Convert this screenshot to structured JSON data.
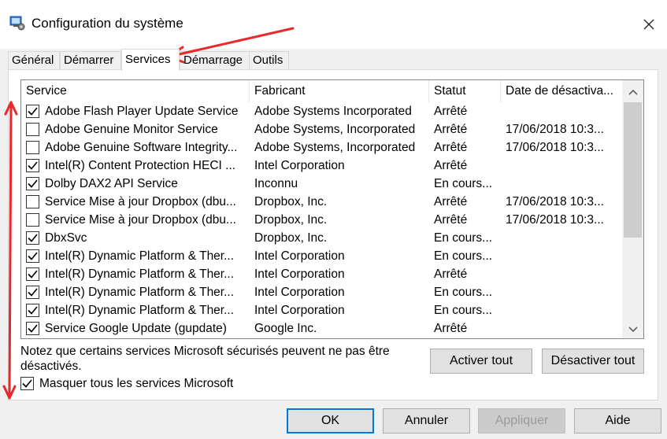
{
  "window": {
    "title": "Configuration du système",
    "close_icon": "close-icon"
  },
  "tabs": [
    {
      "label": "Général",
      "active": false
    },
    {
      "label": "Démarrer",
      "active": false
    },
    {
      "label": "Services",
      "active": true
    },
    {
      "label": "Démarrage",
      "active": false
    },
    {
      "label": "Outils",
      "active": false
    }
  ],
  "services_table": {
    "columns": [
      "Service",
      "Fabricant",
      "Statut",
      "Date de désactiva..."
    ],
    "rows": [
      {
        "checked": true,
        "service": "Adobe Flash Player Update Service",
        "fabricant": "Adobe Systems Incorporated",
        "statut": "Arrêté",
        "date": ""
      },
      {
        "checked": false,
        "service": "Adobe Genuine Monitor Service",
        "fabricant": "Adobe Systems, Incorporated",
        "statut": "Arrêté",
        "date": "17/06/2018 10:3..."
      },
      {
        "checked": false,
        "service": "Adobe Genuine Software Integrity...",
        "fabricant": "Adobe Systems, Incorporated",
        "statut": "Arrêté",
        "date": "17/06/2018 10:3..."
      },
      {
        "checked": true,
        "service": "Intel(R) Content Protection HECI ...",
        "fabricant": "Intel Corporation",
        "statut": "Arrêté",
        "date": ""
      },
      {
        "checked": true,
        "service": "Dolby DAX2 API Service",
        "fabricant": "Inconnu",
        "statut": "En cours...",
        "date": ""
      },
      {
        "checked": false,
        "service": "Service Mise à jour Dropbox (dbu...",
        "fabricant": "Dropbox, Inc.",
        "statut": "Arrêté",
        "date": "17/06/2018 10:3..."
      },
      {
        "checked": false,
        "service": "Service Mise à jour Dropbox (dbu...",
        "fabricant": "Dropbox, Inc.",
        "statut": "Arrêté",
        "date": "17/06/2018 10:3..."
      },
      {
        "checked": true,
        "service": "DbxSvc",
        "fabricant": "Dropbox, Inc.",
        "statut": "En cours...",
        "date": ""
      },
      {
        "checked": true,
        "service": "Intel(R) Dynamic Platform & Ther...",
        "fabricant": "Intel Corporation",
        "statut": "En cours...",
        "date": ""
      },
      {
        "checked": true,
        "service": "Intel(R) Dynamic Platform & Ther...",
        "fabricant": "Intel Corporation",
        "statut": "Arrêté",
        "date": ""
      },
      {
        "checked": true,
        "service": "Intel(R) Dynamic Platform & Ther...",
        "fabricant": "Intel Corporation",
        "statut": "En cours...",
        "date": ""
      },
      {
        "checked": true,
        "service": "Intel(R) Dynamic Platform & Ther...",
        "fabricant": "Intel Corporation",
        "statut": "En cours...",
        "date": ""
      },
      {
        "checked": true,
        "service": "Service Google Update (gupdate)",
        "fabricant": "Google Inc.",
        "statut": "Arrêté",
        "date": ""
      }
    ]
  },
  "note": "Notez que certains services Microsoft sécurisés peuvent ne pas être désactivés.",
  "buttons": {
    "enable_all": "Activer tout",
    "disable_all": "Désactiver tout",
    "ok": "OK",
    "cancel": "Annuler",
    "apply": "Appliquer",
    "help": "Aide"
  },
  "hide_microsoft": {
    "label": "Masquer tous les services Microsoft",
    "checked": true
  },
  "colors": {
    "annotation_red": "#e8282b",
    "focus_blue": "#0078d7"
  }
}
